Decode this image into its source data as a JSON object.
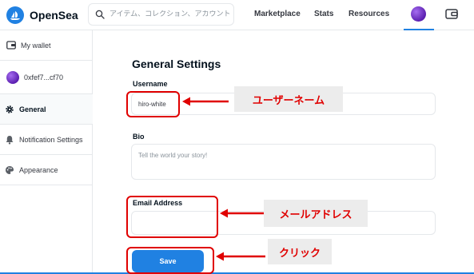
{
  "header": {
    "brand": "OpenSea",
    "search_placeholder": "アイテム、コレクション、アカウントの検索",
    "nav": [
      "Marketplace",
      "Stats",
      "Resources"
    ]
  },
  "sidebar": {
    "my_wallet": "My wallet",
    "address": "0xfef7...cf70",
    "items": [
      {
        "label": "General",
        "icon": "gear-icon",
        "active": true
      },
      {
        "label": "Notification Settings",
        "icon": "bell-icon",
        "active": false
      },
      {
        "label": "Appearance",
        "icon": "palette-icon",
        "active": false
      }
    ]
  },
  "main": {
    "title": "General Settings",
    "username_label": "Username",
    "username_value": "hiro-white",
    "bio_label": "Bio",
    "bio_placeholder": "Tell the world your story!",
    "email_label": "Email Address",
    "email_value": "",
    "save_label": "Save"
  },
  "annotations": {
    "username": "ユーザーネーム",
    "email": "メールアドレス",
    "click": "クリック"
  },
  "colors": {
    "accent": "#2081e2",
    "annotation_red": "#e00000",
    "callout_bg": "#ececec"
  }
}
